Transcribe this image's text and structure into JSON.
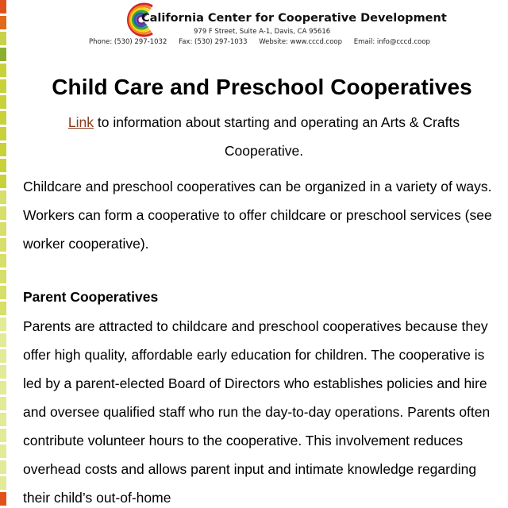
{
  "letterhead": {
    "org_name": "California Center for Cooperative Development",
    "address": "979 F Street, Suite A-1, Davis, CA 95616",
    "phone": "Phone: (530) 297-1032",
    "fax": "Fax: (530) 297-1033",
    "website": "Website: www.cccd.coop",
    "email": "Email: info@cccd.coop"
  },
  "document": {
    "title": "Child Care and Preschool Cooperatives",
    "intro_link": "Link",
    "intro_rest": " to information about starting and operating an Arts & Crafts Cooperative.",
    "paragraph1": "Childcare and preschool cooperatives can be organized in a variety of ways. Workers can form a cooperative to offer childcare or preschool services (see worker cooperative).",
    "section_heading": "Parent Cooperatives",
    "paragraph2": "Parents are attracted to childcare and preschool cooperatives because they offer high quality, affordable early education for children. The cooperative is led by a parent-elected Board of Directors who establishes policies and hire and oversee qualified staff who run the day-to-day operations. Parents often contribute volunteer hours to the cooperative. This involvement reduces overhead costs and allows parent input and intimate knowledge regarding their child’s out-of-home"
  },
  "colors": {
    "link": "#8a3a1a",
    "stripe": [
      "#e0521a",
      "#e06a1a",
      "#c8d14a",
      "#8bb030",
      "#c7d23a",
      "#d7de6a",
      "#e3ea95"
    ]
  },
  "icons": {
    "logo": "rainbow-c-logo-icon"
  }
}
